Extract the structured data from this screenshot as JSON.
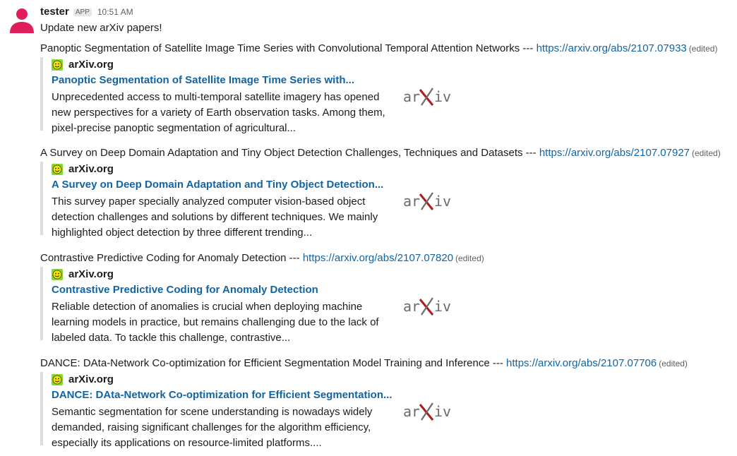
{
  "message": {
    "sender": "tester",
    "badge": "APP",
    "time": "10:51 AM",
    "intro": "Update new arXiv papers!"
  },
  "papers": [
    {
      "title": "Panoptic Segmentation of Satellite Image Time Series with Convolutional  Temporal Attention Networks",
      "sep": " --- ",
      "url": "https://arxiv.org/abs/2107.07933",
      "edited": "(edited)",
      "site": "arXiv.org",
      "unfurl_title": "Panoptic Segmentation of Satellite Image Time Series with...",
      "desc": "Unprecedented access to multi-temporal satellite imagery has opened new perspectives for a variety of Earth observation tasks. Among them, pixel-precise panoptic segmentation of agricultural..."
    },
    {
      "title": "A Survey on Deep Domain Adaptation and Tiny Object Detection Challenges,  Techniques and Datasets",
      "sep": " --- ",
      "url": "https://arxiv.org/abs/2107.07927",
      "edited": "(edited)",
      "site": "arXiv.org",
      "unfurl_title": "A Survey on Deep Domain Adaptation and Tiny Object Detection...",
      "desc": "This survey paper specially analyzed computer vision-based object detection challenges and solutions by different techniques. We mainly highlighted object detection by three different trending..."
    },
    {
      "title": "Contrastive Predictive Coding for Anomaly Detection",
      "sep": " --- ",
      "url": "https://arxiv.org/abs/2107.07820",
      "edited": "(edited)",
      "site": "arXiv.org",
      "unfurl_title": "Contrastive Predictive Coding for Anomaly Detection",
      "desc": "Reliable detection of anomalies is crucial when deploying machine learning models in practice, but remains challenging due to the lack of labeled data. To tackle this challenge, contrastive..."
    },
    {
      "title": "DANCE: DAta-Network Co-optimization for Efficient Segmentation Model  Training and Inference",
      "sep": " --- ",
      "url": "https://arxiv.org/abs/2107.07706",
      "edited": "(edited)",
      "site": "arXiv.org",
      "unfurl_title": "DANCE: DAta-Network Co-optimization for Efficient Segmentation...",
      "desc": "Semantic segmentation for scene understanding is nowadays widely demanded, raising significant challenges for the algorithm efficiency, especially its applications on resource-limited platforms...."
    }
  ],
  "thumb_text": {
    "left": "ar",
    "right": "iv"
  },
  "icons": {
    "avatar": "user-avatar-icon",
    "favicon": "arxiv-smiley-favicon",
    "thumbnail": "arxiv-logo"
  },
  "colors": {
    "link": "#1264a3",
    "avatar": "#e01e5a",
    "favicon_bg": "#7fdc1f",
    "arxiv_x": "#b31b1b",
    "quote_bar": "#dddddd"
  }
}
